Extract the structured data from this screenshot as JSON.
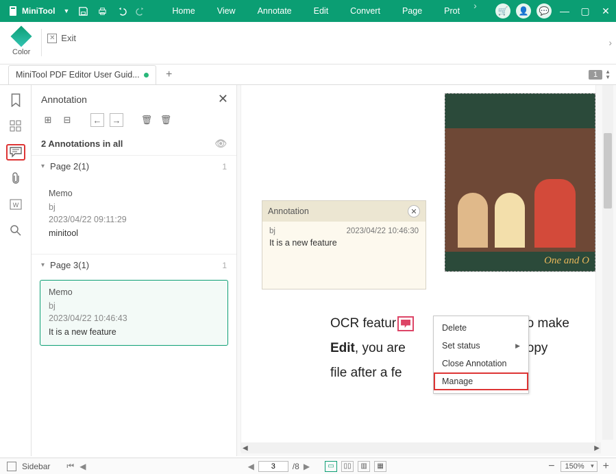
{
  "app": {
    "name": "MiniTool"
  },
  "menus": [
    "Home",
    "View",
    "Annotate",
    "Edit",
    "Convert",
    "Page",
    "Prot"
  ],
  "ribbon": {
    "color_label": "Color",
    "exit_label": "Exit"
  },
  "tab": {
    "title": "MiniTool PDF Editor User Guid..."
  },
  "page_badge": "1",
  "sidepanel": {
    "title": "Annotation",
    "count_text": "2 Annotations in all",
    "groups": [
      {
        "label": "Page 2(1)",
        "count": "1",
        "note": {
          "title": "Memo",
          "author": "bj",
          "ts": "2023/04/22 09:11:29",
          "body": "minitool"
        },
        "selected": false
      },
      {
        "label": "Page 3(1)",
        "count": "1",
        "note": {
          "title": "Memo",
          "author": "bj",
          "ts": "2023/04/22 10:46:43",
          "body": "It is a new feature"
        },
        "selected": true
      }
    ]
  },
  "popup": {
    "title": "Annotation",
    "author": "bj",
    "ts": "2023/04/22 10:46:30",
    "body": "It is a new feature"
  },
  "doc": {
    "line1a": "OCR featur",
    "line1b": " to make",
    "line2a": "Edit",
    "line2b": ", you are ",
    "line2c": "er copy",
    "line3": "file after a fe"
  },
  "context_menu": {
    "items": [
      {
        "label": "Delete",
        "submenu": false,
        "highlight": false
      },
      {
        "label": "Set status",
        "submenu": true,
        "highlight": false
      },
      {
        "label": "Close Annotation",
        "submenu": false,
        "highlight": false
      },
      {
        "label": "Manage",
        "submenu": false,
        "highlight": true
      }
    ]
  },
  "painting_caption": "One and O",
  "bottombar": {
    "sidebar_label": "Sidebar",
    "page_value": "3",
    "page_total": "/8",
    "zoom": "150%"
  }
}
